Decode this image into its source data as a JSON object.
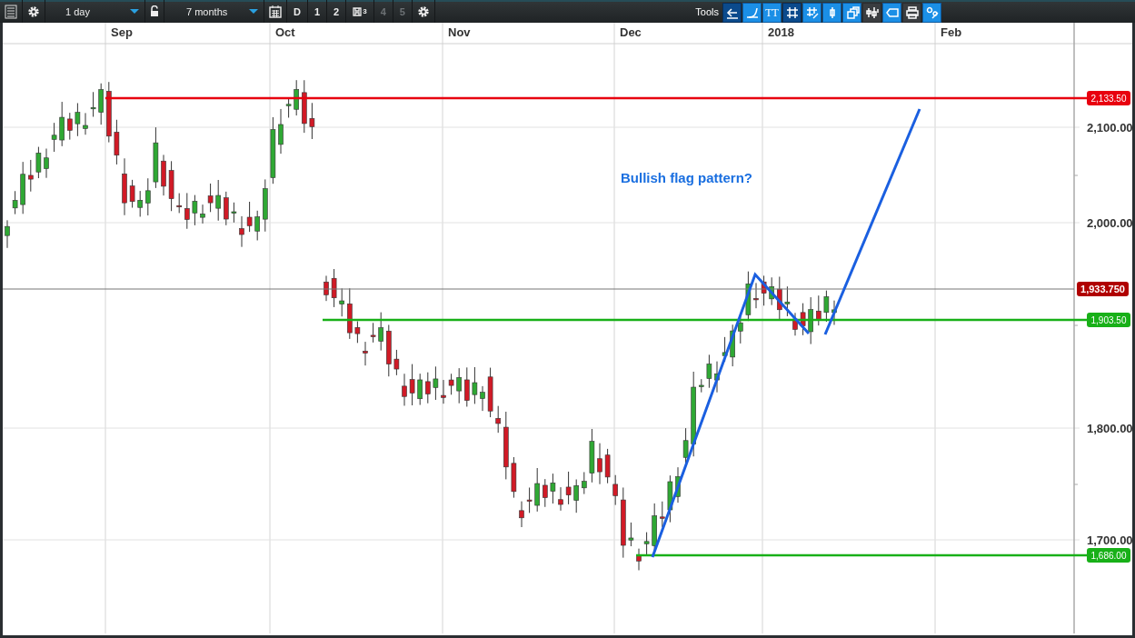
{
  "toolbar": {
    "interval": {
      "value": "1 day"
    },
    "range": {
      "value": "7 months"
    },
    "presets": [
      {
        "label": "D",
        "kind": "text",
        "disabled": false
      },
      {
        "label": "1",
        "kind": "text",
        "disabled": false
      },
      {
        "label": "2",
        "kind": "text",
        "disabled": false
      },
      {
        "label": "3",
        "kind": "saved",
        "disabled": false
      },
      {
        "label": "4",
        "kind": "text",
        "disabled": true
      },
      {
        "label": "5",
        "kind": "text",
        "disabled": true
      }
    ],
    "tools_label": "Tools",
    "tools": [
      {
        "selected": true,
        "kind": "toggle"
      },
      {
        "selected": false,
        "kind": "toggle"
      },
      {
        "selected": false,
        "kind": "toggle",
        "label": "TT"
      },
      {
        "selected": true,
        "kind": "toggle"
      },
      {
        "selected": false,
        "kind": "toggle"
      },
      {
        "selected": false,
        "kind": "toggle"
      },
      {
        "selected": false,
        "kind": "toggle"
      },
      {
        "kind": "action"
      },
      {
        "selected": false,
        "kind": "toggle"
      },
      {
        "kind": "action"
      },
      {
        "selected": false,
        "kind": "toggle"
      }
    ]
  },
  "chart": {
    "months": [
      "Sep",
      "Oct",
      "Nov",
      "Dec",
      "2018",
      "Feb"
    ],
    "y_ticks": [
      "2,100.00",
      "2,000.00",
      "1,800.00",
      "1,700.00"
    ],
    "annotation": "Bullish flag pattern?",
    "price_levels": [
      {
        "label": "2,133.50",
        "color": "#e8000f",
        "kind": "drawn"
      },
      {
        "label": "1,933.750",
        "color": "#b00000",
        "kind": "last"
      },
      {
        "label": "1,903.50",
        "color": "#18b018",
        "kind": "drawn"
      },
      {
        "label": "1,686.00",
        "color": "#18b018",
        "kind": "drawn"
      }
    ]
  }
}
